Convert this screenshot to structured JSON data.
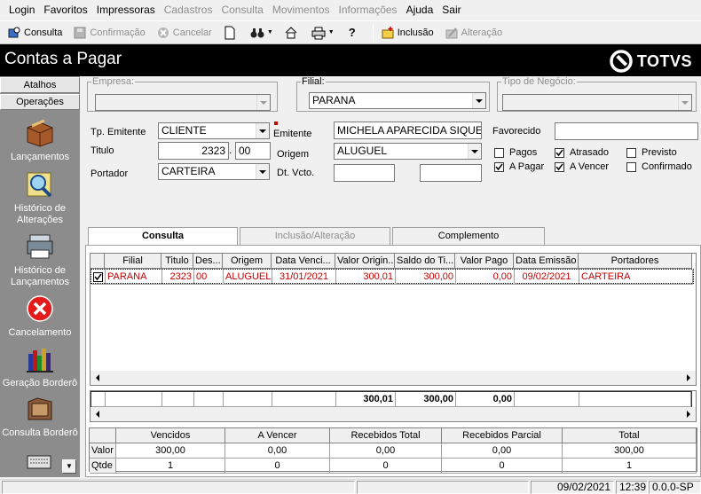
{
  "menu": [
    {
      "label": "Login",
      "enabled": true
    },
    {
      "label": "Favoritos",
      "enabled": true
    },
    {
      "label": "Impressoras",
      "enabled": true
    },
    {
      "label": "Cadastros",
      "enabled": false
    },
    {
      "label": "Consulta",
      "enabled": false
    },
    {
      "label": "Movimentos",
      "enabled": false
    },
    {
      "label": "Informações",
      "enabled": false
    },
    {
      "label": "Ajuda",
      "enabled": true
    },
    {
      "label": "Sair",
      "enabled": true
    }
  ],
  "toolbar": {
    "consulta": "Consulta",
    "confirmacao": "Confirmação",
    "cancelar": "Cancelar",
    "inclusao": "Inclusão",
    "alteracao": "Alteração"
  },
  "window_title": "Contas a Pagar",
  "logo_text": "TOTVS",
  "sidebar": {
    "tabs": [
      "Atalhos",
      "Operações"
    ],
    "items": [
      {
        "label": "Lançamentos",
        "icon": "box-icon"
      },
      {
        "label": "Histórico de Alterações",
        "icon": "magnifier-icon"
      },
      {
        "label": "Histórico de Lançamentos",
        "icon": "printer-stack-icon"
      },
      {
        "label": "Cancelamento",
        "icon": "cancel-x-icon"
      },
      {
        "label": "Geração Borderô",
        "icon": "books-icon"
      },
      {
        "label": "Consulta Borderô",
        "icon": "folder-icon"
      }
    ]
  },
  "form": {
    "empresa_label": "Empresa:",
    "empresa_value": "",
    "filial_label": "Filial:",
    "filial_value": "PARANA",
    "tipo_negocio_label": "Tipo de Negócio:",
    "tipo_negocio_value": "",
    "tp_emitente_label": "Tp. Emitente",
    "tp_emitente_value": "CLIENTE",
    "emitente_label": "Emitente",
    "emitente_value": "MICHELA APARECIDA SIQUEIRA",
    "favorecido_label": "Favorecido",
    "favorecido_value": "",
    "titulo_label": "Titulo",
    "titulo_value": "2323",
    "titulo_sep": ".",
    "titulo_seq": "00",
    "origem_label": "Origem",
    "origem_value": "ALUGUEL",
    "portador_label": "Portador",
    "portador_value": "CARTEIRA",
    "dtvcto_label": "Dt. Vcto.",
    "dtvcto_from": "",
    "dtvcto_to": "",
    "checks": [
      {
        "label": "Pagos",
        "checked": false
      },
      {
        "label": "Atrasado",
        "checked": true
      },
      {
        "label": "Previsto",
        "checked": false
      },
      {
        "label": "A Pagar",
        "checked": true
      },
      {
        "label": "A Vencer",
        "checked": true
      },
      {
        "label": "Confirmado",
        "checked": false
      }
    ]
  },
  "tabs": [
    {
      "label": "Consulta",
      "active": true
    },
    {
      "label": "Inclusão/Alteração",
      "active": false
    },
    {
      "label": "Complemento",
      "active": false
    }
  ],
  "grid": {
    "columns": [
      "Filial",
      "Titulo",
      "Des...",
      "Origem",
      "Data Venci...",
      "Valor Origin...",
      "Saldo do Ti...",
      "Valor Pago",
      "Data Emissão",
      "Portadores"
    ],
    "rows": [
      [
        "PARANA",
        "2323",
        "00",
        "ALUGUEL",
        "31/01/2021",
        "300,01",
        "300,00",
        "0,00",
        "09/02/2021",
        "CARTEIRA"
      ]
    ],
    "totals": {
      "valor_original": "300,01",
      "saldo": "300,00",
      "valor_pago": "0,00"
    }
  },
  "summary": {
    "columns": [
      "Vencidos",
      "A Vencer",
      "Recebidos Total",
      "Recebidos Parcial",
      "Total"
    ],
    "rows": [
      {
        "label": "Valor",
        "values": [
          "300,00",
          "0,00",
          "0,00",
          "0,00",
          "300,00"
        ]
      },
      {
        "label": "Qtde",
        "values": [
          "1",
          "0",
          "0",
          "0",
          "1"
        ]
      }
    ]
  },
  "statusbar": {
    "date": "09/02/2021",
    "time": "12:39",
    "version": "0.0.0-SP"
  }
}
